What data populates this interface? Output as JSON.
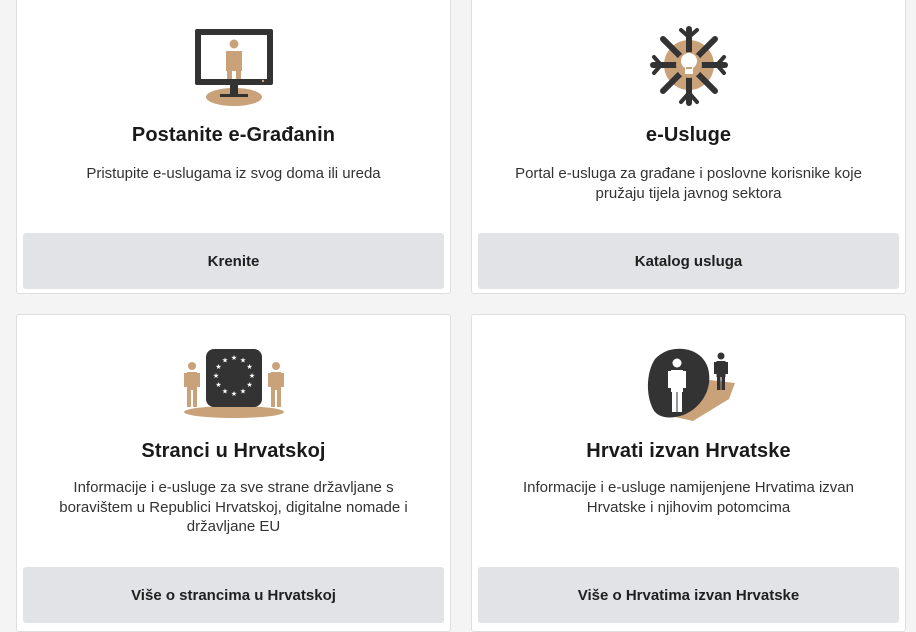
{
  "colors": {
    "accent": "#c9a27a",
    "dark": "#333333",
    "button_bg": "#e2e3e7",
    "card_bg": "#ffffff",
    "page_bg": "#f4f4f5"
  },
  "cards": [
    {
      "icon": "computer-user-icon",
      "title": "Postanite e-Građanin",
      "description": "Pristupite e-uslugama iz svog doma ili ureda",
      "button_label": "Krenite"
    },
    {
      "icon": "e-services-icon",
      "title": "e-Usluge",
      "description": "Portal e-usluga za građane i poslovne korisnike koje pružaju tijela javnog sektora",
      "button_label": "Katalog usluga"
    },
    {
      "icon": "eu-foreigners-icon",
      "title": "Stranci u Hrvatskoj",
      "description": "Informacije i e-usluge za sve strane državljane s boravištem u Republici Hrvatskoj, digitalne nomade i državljane EU",
      "button_label": "Više o strancima u Hrvatskoj"
    },
    {
      "icon": "croats-abroad-icon",
      "title": "Hrvati izvan Hrvatske",
      "description": "Informacije i e-usluge namijenjene Hrvatima izvan Hrvatske i njihovim potomcima",
      "button_label": "Više o Hrvatima izvan Hrvatske"
    }
  ]
}
